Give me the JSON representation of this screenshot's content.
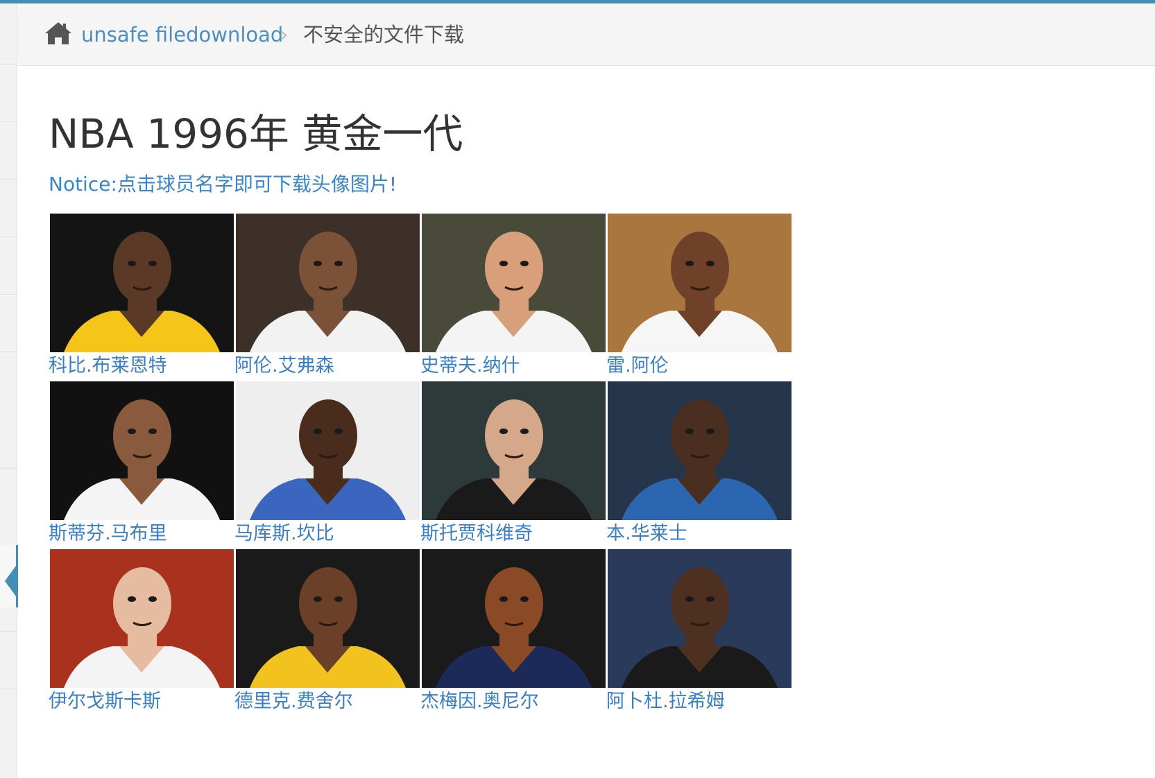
{
  "breadcrumb": {
    "home_icon": "home-icon",
    "link_label": "unsafe filedownload",
    "separator": "›",
    "current_label": "不安全的文件下载"
  },
  "main": {
    "title": "NBA 1996年 黄金一代",
    "notice": "Notice:点击球员名字即可下载头像图片!"
  },
  "players": [
    {
      "name": "科比.布莱恩特",
      "bg": "#141414",
      "skin": "#5a3a26",
      "jersey": "#f5c518"
    },
    {
      "name": "阿伦.艾弗森",
      "bg": "#3d3028",
      "skin": "#7a5238",
      "jersey": "#f2f2f2"
    },
    {
      "name": "史蒂夫.纳什",
      "bg": "#4a4a3a",
      "skin": "#d8a07a",
      "jersey": "#f4f4f4"
    },
    {
      "name": "雷.阿伦",
      "bg": "#a8763e",
      "skin": "#6e4128",
      "jersey": "#f6f6f6"
    },
    {
      "name": "斯蒂芬.马布里",
      "bg": "#111111",
      "skin": "#8a5a3c",
      "jersey": "#f4f4f4"
    },
    {
      "name": "马库斯.坎比",
      "bg": "#eeeeee",
      "skin": "#4a2c1c",
      "jersey": "#3a66c0"
    },
    {
      "name": "斯托贾科维奇",
      "bg": "#2e3a3a",
      "skin": "#d4a888",
      "jersey": "#1a1a1a"
    },
    {
      "name": "本.华莱士",
      "bg": "#25354a",
      "skin": "#4a2e20",
      "jersey": "#2d66b0"
    },
    {
      "name": "伊尔戈斯卡斯",
      "bg": "#a8321e",
      "skin": "#e6bca0",
      "jersey": "#f4f4f4"
    },
    {
      "name": "德里克.费舍尔",
      "bg": "#1a1a1a",
      "skin": "#6a4028",
      "jersey": "#f2c21e"
    },
    {
      "name": "杰梅因.奥尼尔",
      "bg": "#1a1a1a",
      "skin": "#8a4a26",
      "jersey": "#1c2a5a"
    },
    {
      "name": "阿卜杜.拉希姆",
      "bg": "#2a3a5a",
      "skin": "#4e3020",
      "jersey": "#1a1a1a"
    }
  ]
}
